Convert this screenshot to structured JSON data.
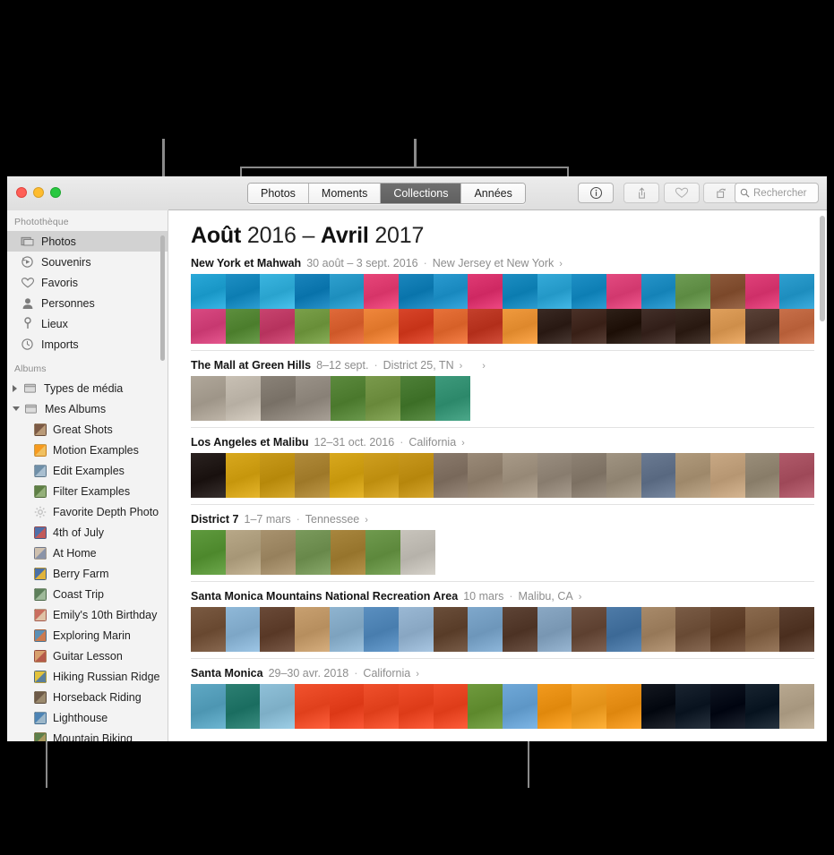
{
  "window": {
    "traffic_lights": [
      "close",
      "minimize",
      "zoom"
    ]
  },
  "toolbar": {
    "segments": [
      {
        "label": "Photos",
        "active": false
      },
      {
        "label": "Moments",
        "active": false
      },
      {
        "label": "Collections",
        "active": true
      },
      {
        "label": "Années",
        "active": false
      }
    ],
    "buttons": [
      {
        "name": "info-button",
        "icon": "info-icon",
        "enabled": true
      },
      {
        "name": "share-button",
        "icon": "share-icon",
        "enabled": false
      },
      {
        "name": "favorite-button",
        "icon": "heart-icon",
        "enabled": false
      },
      {
        "name": "rotate-button",
        "icon": "rotate-icon",
        "enabled": false
      }
    ],
    "search": {
      "placeholder": "Rechercher",
      "value": "",
      "icon": "search-icon"
    }
  },
  "sidebar": {
    "sections": [
      {
        "header": "Photothèque",
        "items": [
          {
            "label": "Photos",
            "icon": "photos-icon",
            "selected": true
          },
          {
            "label": "Souvenirs",
            "icon": "memories-icon",
            "selected": false
          },
          {
            "label": "Favoris",
            "icon": "heart-icon",
            "selected": false
          },
          {
            "label": "Personnes",
            "icon": "person-icon",
            "selected": false
          },
          {
            "label": "Lieux",
            "icon": "pin-icon",
            "selected": false
          },
          {
            "label": "Imports",
            "icon": "clock-icon",
            "selected": false
          }
        ]
      },
      {
        "header": "Albums",
        "groups": [
          {
            "label": "Types de média",
            "expanded": false,
            "icon": "folder-icon"
          },
          {
            "label": "Mes Albums",
            "expanded": true,
            "icon": "folder-icon"
          }
        ],
        "albums": [
          {
            "label": "Great Shots",
            "colors": [
              "#7c5a45",
              "#b99a78"
            ]
          },
          {
            "label": "Motion Examples",
            "colors": [
              "#f79a1e",
              "#f0c060"
            ]
          },
          {
            "label": "Edit Examples",
            "colors": [
              "#6f8fa8",
              "#a9bfd0"
            ]
          },
          {
            "label": "Filter Examples",
            "colors": [
              "#5e7f45",
              "#94b07a"
            ]
          },
          {
            "label": "Favorite Depth Photo",
            "colors": [
              "#d9d9d9",
              "#bdbdbd"
            ],
            "icon": "gear-icon"
          },
          {
            "label": "4th of July",
            "colors": [
              "#4f6fa8",
              "#c25a5a"
            ]
          },
          {
            "label": "At Home",
            "colors": [
              "#cfc0ae",
              "#8a93a8"
            ]
          },
          {
            "label": "Berry Farm",
            "colors": [
              "#4a6fa5",
              "#e0b43c"
            ]
          },
          {
            "label": "Coast Trip",
            "colors": [
              "#5d7f5a",
              "#9fb99a"
            ]
          },
          {
            "label": "Emily's 10th Birthday",
            "colors": [
              "#c96d5e",
              "#dfc2a6"
            ]
          },
          {
            "label": "Exploring Marin",
            "colors": [
              "#5b8fb5",
              "#cc7a4e"
            ]
          },
          {
            "label": "Guitar Lesson",
            "colors": [
              "#d8a06d",
              "#b65a4a"
            ]
          },
          {
            "label": "Hiking Russian Ridge",
            "colors": [
              "#e2c23c",
              "#5a7f9b"
            ]
          },
          {
            "label": "Horseback Riding",
            "colors": [
              "#6d5a48",
              "#9b8a6e"
            ]
          },
          {
            "label": "Lighthouse",
            "colors": [
              "#4d84b5",
              "#9cb7c9"
            ]
          },
          {
            "label": "Mountain Biking",
            "colors": [
              "#5c7f4a",
              "#a8985e"
            ]
          }
        ]
      }
    ]
  },
  "main": {
    "title": {
      "month1": "Août",
      "year1": "2016",
      "dash": "–",
      "month2": "Avril",
      "year2": "2017"
    },
    "collections": [
      {
        "name": "New York et Mahwah",
        "dates": "30 août – 3 sept. 2016",
        "location": "New Jersey et New York",
        "chevron": "›",
        "extra_chevron": null,
        "rows": 2,
        "strip_height": 78,
        "photos": [
          [
            "#2aa8d8",
            "#1e8fc4",
            "#3bb5e0",
            "#1a84bc",
            "#2fa0cf",
            "#e8467a",
            "#1b86bd",
            "#2a9ad0",
            "#e03a74",
            "#1d8ec2",
            "#35aad9",
            "#1f90c6",
            "#e34a80",
            "#2694c9",
            "#6e9c54",
            "#8d5a3c",
            "#e0417a",
            "#2f9fd0"
          ],
          [
            "#d94a82",
            "#5d8f3e",
            "#c8446f",
            "#7aa04a",
            "#e06a3a",
            "#f0873c",
            "#d8452a",
            "#e8723a",
            "#c4402c",
            "#f09a3e",
            "#3a2a24",
            "#4a3128",
            "#2e2018",
            "#43302a",
            "#3a2a22",
            "#e0a05c",
            "#5a4238",
            "#c8704a"
          ]
        ]
      },
      {
        "name": "The Mall at Green Hills",
        "dates": "8–12 sept.",
        "location": "District 25, TN",
        "chevron": "›",
        "extra_chevron": "›",
        "rows": 1,
        "strip_height": 50,
        "photos": [
          [
            "#b0a79a",
            "#c8c0b4",
            "#8a8278",
            "#9a9288",
            "#5c8a3e",
            "#7a9a4c",
            "#4e8038",
            "#3e9a7c"
          ]
        ]
      },
      {
        "name": "Los Angeles et Malibu",
        "dates": "12–31 oct. 2016",
        "location": "California",
        "chevron": "›",
        "extra_chevron": null,
        "rows": 1,
        "strip_height": 50,
        "photos": [
          [
            "#2a2220",
            "#d8a81e",
            "#c89a1c",
            "#b08a3a",
            "#d8a81e",
            "#cf9f20",
            "#c8981e",
            "#8a7a6c",
            "#9a8a78",
            "#a89a88",
            "#9a8e80",
            "#8e8274",
            "#a09482",
            "#6a7a92",
            "#b09a7c",
            "#c8a884",
            "#9a8e7a",
            "#b05a6a"
          ]
        ]
      },
      {
        "name": "District 7",
        "dates": "1–7 mars",
        "location": "Tennessee",
        "chevron": "›",
        "extra_chevron": null,
        "rows": 1,
        "strip_height": 50,
        "photos": [
          [
            "#5f9a3e",
            "#b8a888",
            "#a8926e",
            "#7a9a5c",
            "#a8863e",
            "#6f9a4e",
            "#c8c4bc"
          ]
        ]
      },
      {
        "name": "Santa Monica Mountains National Recreation Area",
        "dates": "10 mars",
        "location": "Malibu, CA",
        "chevron": "›",
        "extra_chevron": null,
        "rows": 1,
        "strip_height": 50,
        "photos": [
          [
            "#7a5a42",
            "#8fb8d8",
            "#6a4a38",
            "#c8a070",
            "#8fb4d0",
            "#5a8fc0",
            "#9ab8d4",
            "#6a4e3a",
            "#7fa8cc",
            "#5e4436",
            "#8aa8c4",
            "#6f5242",
            "#4e7ba8",
            "#a88a6a",
            "#7a5c46",
            "#6a4a34",
            "#8a6a4e",
            "#5c4030"
          ]
        ]
      },
      {
        "name": "Santa Monica",
        "dates": "29–30 avr. 2018",
        "location": "California",
        "chevron": "›",
        "extra_chevron": null,
        "rows": 1,
        "strip_height": 50,
        "photos": [
          [
            "#5fa8c4",
            "#2c7f72",
            "#8fc0d8",
            "#f2522e",
            "#ee4a28",
            "#f0502c",
            "#ef4d2a",
            "#f04e2b",
            "#6f9a3e",
            "#6fa8d8",
            "#f29a1e",
            "#f4a32a",
            "#f09820",
            "#141820",
            "#1a2430",
            "#101622",
            "#182430",
            "#b8a890"
          ]
        ]
      }
    ]
  }
}
